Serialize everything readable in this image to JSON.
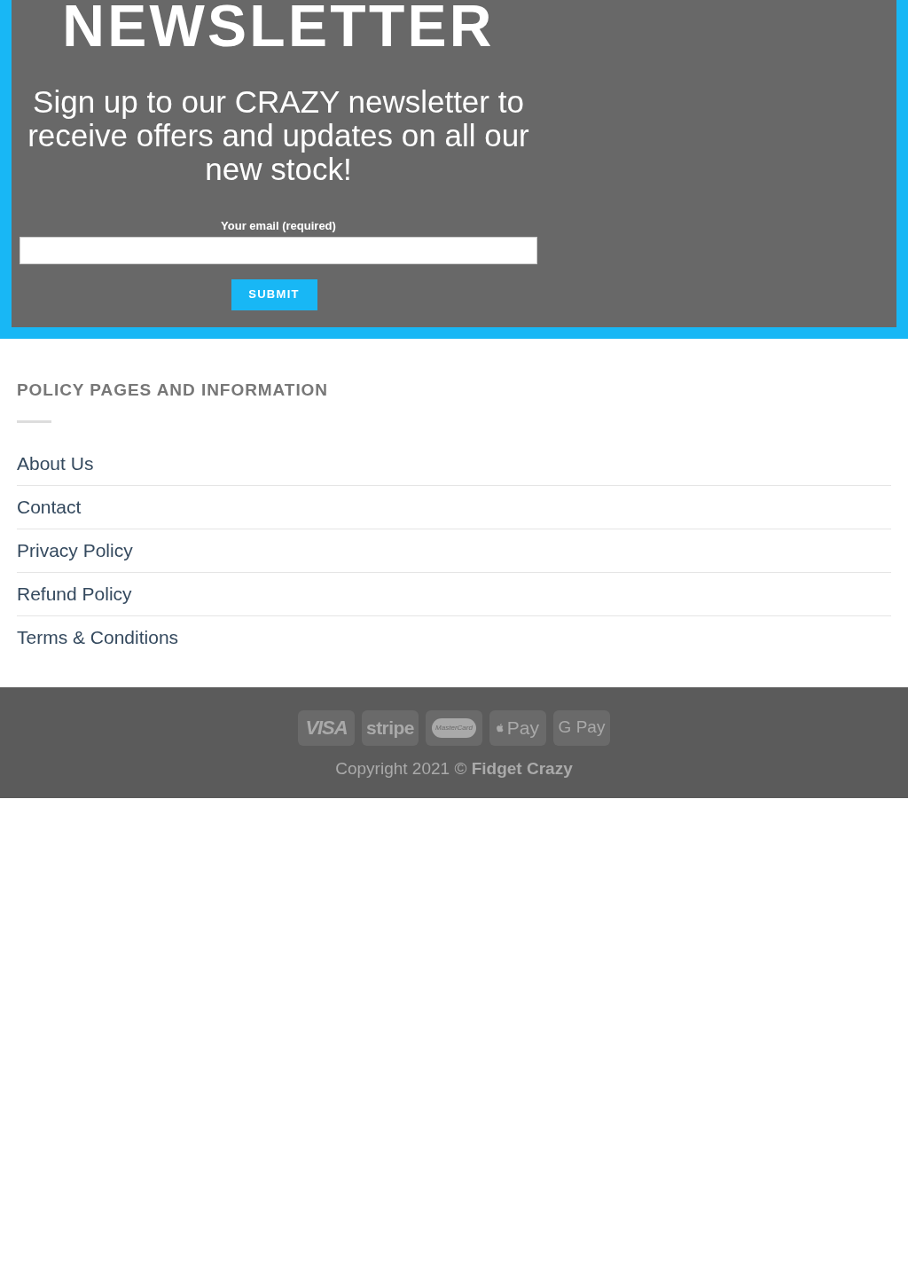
{
  "newsletter": {
    "title": "NEWSLETTER",
    "subtitle": "Sign up to our CRAZY newsletter to receive offers and updates on all our new stock!",
    "email_label": "Your email (required)",
    "submit": "SUBMIT"
  },
  "policy": {
    "heading": "POLICY PAGES AND INFORMATION",
    "links": [
      "About Us",
      "Contact",
      "Privacy Policy",
      "Refund Policy",
      "Terms & Conditions"
    ]
  },
  "footer": {
    "payments": [
      {
        "kind": "visa",
        "label": "VISA"
      },
      {
        "kind": "stripe",
        "label": "stripe"
      },
      {
        "kind": "mastercard",
        "label": "MasterCard"
      },
      {
        "kind": "applepay",
        "label": "Pay"
      },
      {
        "kind": "googlepay",
        "label": "G Pay"
      }
    ],
    "copyright": "Copyright 2021 © **Fidget Crazy**"
  }
}
